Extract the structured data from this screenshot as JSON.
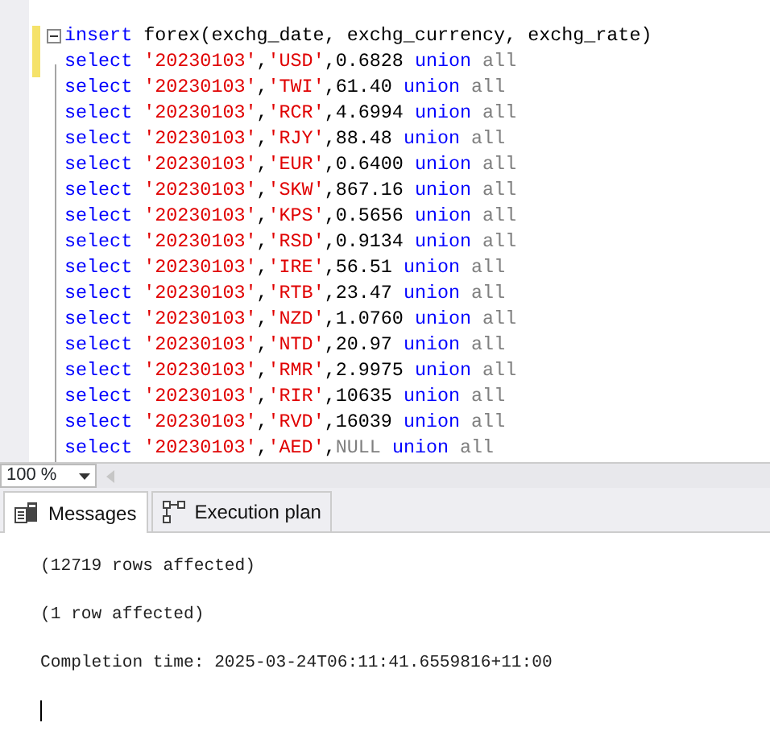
{
  "editor": {
    "lines": [
      [
        {
          "kind": "keyword",
          "text": "insert"
        },
        {
          "kind": "plain",
          "text": " forex(exchg_date, exchg_currency, exchg_rate)"
        }
      ],
      [
        {
          "kind": "keyword",
          "text": "select "
        },
        {
          "kind": "string",
          "text": "'20230103'"
        },
        {
          "kind": "plain",
          "text": ","
        },
        {
          "kind": "string",
          "text": "'USD'"
        },
        {
          "kind": "plain",
          "text": ",0.6828 "
        },
        {
          "kind": "keyword",
          "text": "union "
        },
        {
          "kind": "operator",
          "text": "all"
        }
      ],
      [
        {
          "kind": "keyword",
          "text": "select "
        },
        {
          "kind": "string",
          "text": "'20230103'"
        },
        {
          "kind": "plain",
          "text": ","
        },
        {
          "kind": "string",
          "text": "'TWI'"
        },
        {
          "kind": "plain",
          "text": ",61.40 "
        },
        {
          "kind": "keyword",
          "text": "union "
        },
        {
          "kind": "operator",
          "text": "all"
        }
      ],
      [
        {
          "kind": "keyword",
          "text": "select "
        },
        {
          "kind": "string",
          "text": "'20230103'"
        },
        {
          "kind": "plain",
          "text": ","
        },
        {
          "kind": "string",
          "text": "'RCR'"
        },
        {
          "kind": "plain",
          "text": ",4.6994 "
        },
        {
          "kind": "keyword",
          "text": "union "
        },
        {
          "kind": "operator",
          "text": "all"
        }
      ],
      [
        {
          "kind": "keyword",
          "text": "select "
        },
        {
          "kind": "string",
          "text": "'20230103'"
        },
        {
          "kind": "plain",
          "text": ","
        },
        {
          "kind": "string",
          "text": "'RJY'"
        },
        {
          "kind": "plain",
          "text": ",88.48 "
        },
        {
          "kind": "keyword",
          "text": "union "
        },
        {
          "kind": "operator",
          "text": "all"
        }
      ],
      [
        {
          "kind": "keyword",
          "text": "select "
        },
        {
          "kind": "string",
          "text": "'20230103'"
        },
        {
          "kind": "plain",
          "text": ","
        },
        {
          "kind": "string",
          "text": "'EUR'"
        },
        {
          "kind": "plain",
          "text": ",0.6400 "
        },
        {
          "kind": "keyword",
          "text": "union "
        },
        {
          "kind": "operator",
          "text": "all"
        }
      ],
      [
        {
          "kind": "keyword",
          "text": "select "
        },
        {
          "kind": "string",
          "text": "'20230103'"
        },
        {
          "kind": "plain",
          "text": ","
        },
        {
          "kind": "string",
          "text": "'SKW'"
        },
        {
          "kind": "plain",
          "text": ",867.16 "
        },
        {
          "kind": "keyword",
          "text": "union "
        },
        {
          "kind": "operator",
          "text": "all"
        }
      ],
      [
        {
          "kind": "keyword",
          "text": "select "
        },
        {
          "kind": "string",
          "text": "'20230103'"
        },
        {
          "kind": "plain",
          "text": ","
        },
        {
          "kind": "string",
          "text": "'KPS'"
        },
        {
          "kind": "plain",
          "text": ",0.5656 "
        },
        {
          "kind": "keyword",
          "text": "union "
        },
        {
          "kind": "operator",
          "text": "all"
        }
      ],
      [
        {
          "kind": "keyword",
          "text": "select "
        },
        {
          "kind": "string",
          "text": "'20230103'"
        },
        {
          "kind": "plain",
          "text": ","
        },
        {
          "kind": "string",
          "text": "'RSD'"
        },
        {
          "kind": "plain",
          "text": ",0.9134 "
        },
        {
          "kind": "keyword",
          "text": "union "
        },
        {
          "kind": "operator",
          "text": "all"
        }
      ],
      [
        {
          "kind": "keyword",
          "text": "select "
        },
        {
          "kind": "string",
          "text": "'20230103'"
        },
        {
          "kind": "plain",
          "text": ","
        },
        {
          "kind": "string",
          "text": "'IRE'"
        },
        {
          "kind": "plain",
          "text": ",56.51 "
        },
        {
          "kind": "keyword",
          "text": "union "
        },
        {
          "kind": "operator",
          "text": "all"
        }
      ],
      [
        {
          "kind": "keyword",
          "text": "select "
        },
        {
          "kind": "string",
          "text": "'20230103'"
        },
        {
          "kind": "plain",
          "text": ","
        },
        {
          "kind": "string",
          "text": "'RTB'"
        },
        {
          "kind": "plain",
          "text": ",23.47 "
        },
        {
          "kind": "keyword",
          "text": "union "
        },
        {
          "kind": "operator",
          "text": "all"
        }
      ],
      [
        {
          "kind": "keyword",
          "text": "select "
        },
        {
          "kind": "string",
          "text": "'20230103'"
        },
        {
          "kind": "plain",
          "text": ","
        },
        {
          "kind": "string",
          "text": "'NZD'"
        },
        {
          "kind": "plain",
          "text": ",1.0760 "
        },
        {
          "kind": "keyword",
          "text": "union "
        },
        {
          "kind": "operator",
          "text": "all"
        }
      ],
      [
        {
          "kind": "keyword",
          "text": "select "
        },
        {
          "kind": "string",
          "text": "'20230103'"
        },
        {
          "kind": "plain",
          "text": ","
        },
        {
          "kind": "string",
          "text": "'NTD'"
        },
        {
          "kind": "plain",
          "text": ",20.97 "
        },
        {
          "kind": "keyword",
          "text": "union "
        },
        {
          "kind": "operator",
          "text": "all"
        }
      ],
      [
        {
          "kind": "keyword",
          "text": "select "
        },
        {
          "kind": "string",
          "text": "'20230103'"
        },
        {
          "kind": "plain",
          "text": ","
        },
        {
          "kind": "string",
          "text": "'RMR'"
        },
        {
          "kind": "plain",
          "text": ",2.9975 "
        },
        {
          "kind": "keyword",
          "text": "union "
        },
        {
          "kind": "operator",
          "text": "all"
        }
      ],
      [
        {
          "kind": "keyword",
          "text": "select "
        },
        {
          "kind": "string",
          "text": "'20230103'"
        },
        {
          "kind": "plain",
          "text": ","
        },
        {
          "kind": "string",
          "text": "'RIR'"
        },
        {
          "kind": "plain",
          "text": ",10635 "
        },
        {
          "kind": "keyword",
          "text": "union "
        },
        {
          "kind": "operator",
          "text": "all"
        }
      ],
      [
        {
          "kind": "keyword",
          "text": "select "
        },
        {
          "kind": "string",
          "text": "'20230103'"
        },
        {
          "kind": "plain",
          "text": ","
        },
        {
          "kind": "string",
          "text": "'RVD'"
        },
        {
          "kind": "plain",
          "text": ",16039 "
        },
        {
          "kind": "keyword",
          "text": "union "
        },
        {
          "kind": "operator",
          "text": "all"
        }
      ],
      [
        {
          "kind": "keyword",
          "text": "select "
        },
        {
          "kind": "string",
          "text": "'20230103'"
        },
        {
          "kind": "plain",
          "text": ","
        },
        {
          "kind": "string",
          "text": "'AED'"
        },
        {
          "kind": "plain",
          "text": ","
        },
        {
          "kind": "operator",
          "text": "NULL "
        },
        {
          "kind": "keyword",
          "text": "union "
        },
        {
          "kind": "operator",
          "text": "all"
        }
      ]
    ]
  },
  "zoom": {
    "value": "100 %"
  },
  "tabs": [
    {
      "label": "Messages",
      "selected": true
    },
    {
      "label": "Execution plan",
      "selected": false
    }
  ],
  "messages": [
    "(12719 rows affected)",
    "(1 row affected)",
    "Completion time: 2025-03-24T06:11:41.6559816+11:00"
  ]
}
